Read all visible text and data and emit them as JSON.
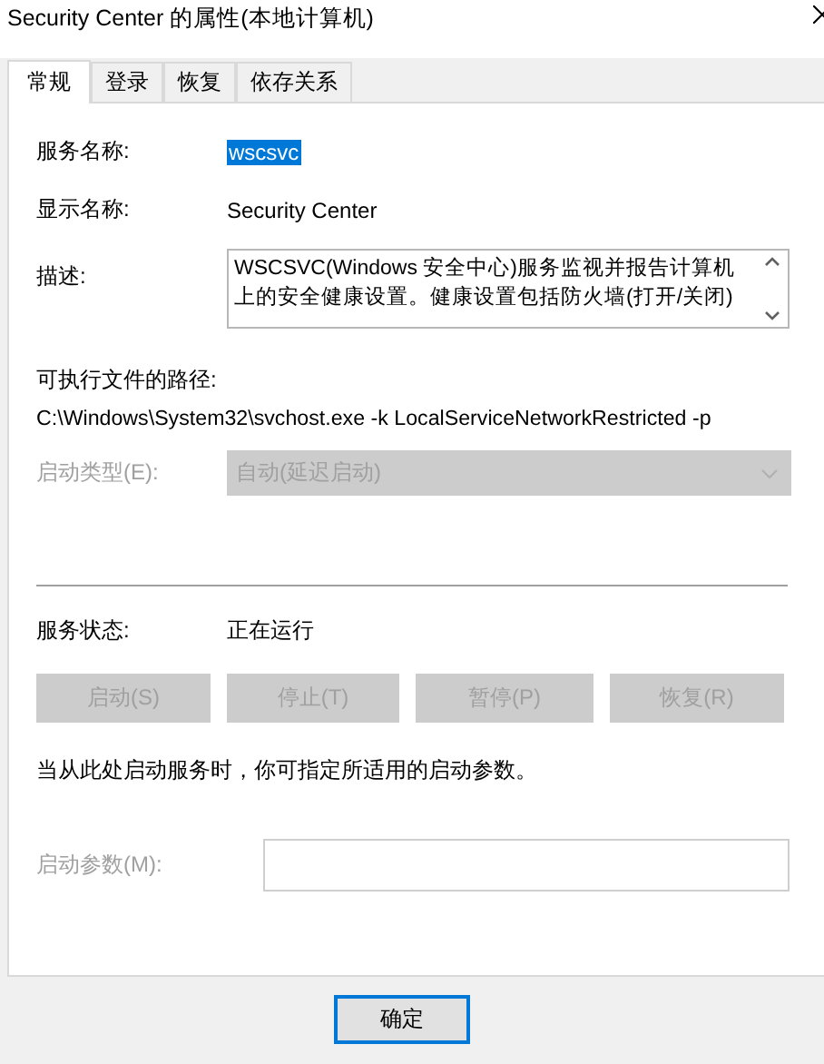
{
  "window": {
    "title": "Security Center 的属性(本地计算机)"
  },
  "tabs": [
    {
      "label": "常规",
      "selected": true
    },
    {
      "label": "登录",
      "selected": false
    },
    {
      "label": "恢复",
      "selected": false
    },
    {
      "label": "依存关系",
      "selected": false
    }
  ],
  "service_name": {
    "label": "服务名称:",
    "value": "wscsvc",
    "selected": true
  },
  "display_name": {
    "label": "显示名称:",
    "value": "Security Center"
  },
  "description": {
    "label": "描述:",
    "lines": [
      "WSCSVC(Windows 安全中心)服务监视并报告计算机",
      "上的安全健康设置。健康设置包括防火墙(打开/关闭)"
    ]
  },
  "executable_path": {
    "label": "可执行文件的路径:",
    "value": "C:\\Windows\\System32\\svchost.exe -k LocalServiceNetworkRestricted -p"
  },
  "startup_type": {
    "label": "启动类型(E):",
    "value": "自动(延迟启动)",
    "disabled": true
  },
  "service_status": {
    "label": "服务状态:",
    "value": "正在运行"
  },
  "service_buttons": [
    {
      "label": "启动(S)",
      "disabled": true
    },
    {
      "label": "停止(T)",
      "disabled": true
    },
    {
      "label": "暂停(P)",
      "disabled": true
    },
    {
      "label": "恢复(R)",
      "disabled": true
    }
  ],
  "hint": "当从此处启动服务时，你可指定所适用的启动参数。",
  "start_parameters": {
    "label": "启动参数(M):",
    "disabled": true
  },
  "dialog_buttons": [
    {
      "label": "确定",
      "default": true
    }
  ]
}
